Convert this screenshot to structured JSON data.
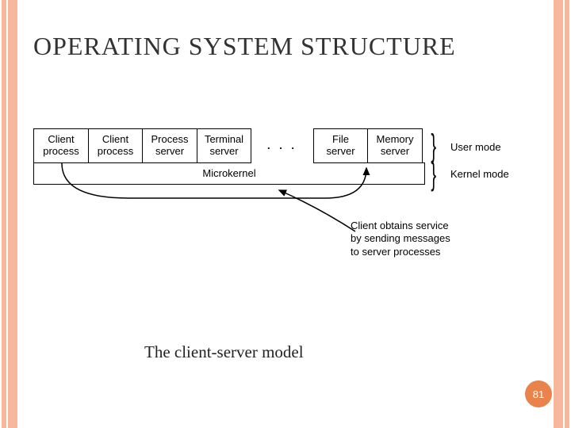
{
  "title": "OPERATING SYSTEM STRUCTURE",
  "caption": "The client-server model",
  "page": "81",
  "boxes": {
    "client1": "Client\nprocess",
    "client2": "Client\nprocess",
    "process_server": "Process\nserver",
    "terminal_server": "Terminal\nserver",
    "dots": ". . .",
    "file_server": "File\nserver",
    "memory_server": "Memory\nserver",
    "microkernel": "Microkernel"
  },
  "modes": {
    "user": "User mode",
    "kernel": "Kernel mode"
  },
  "annotation": "Client obtains service by sending messages to server processes"
}
